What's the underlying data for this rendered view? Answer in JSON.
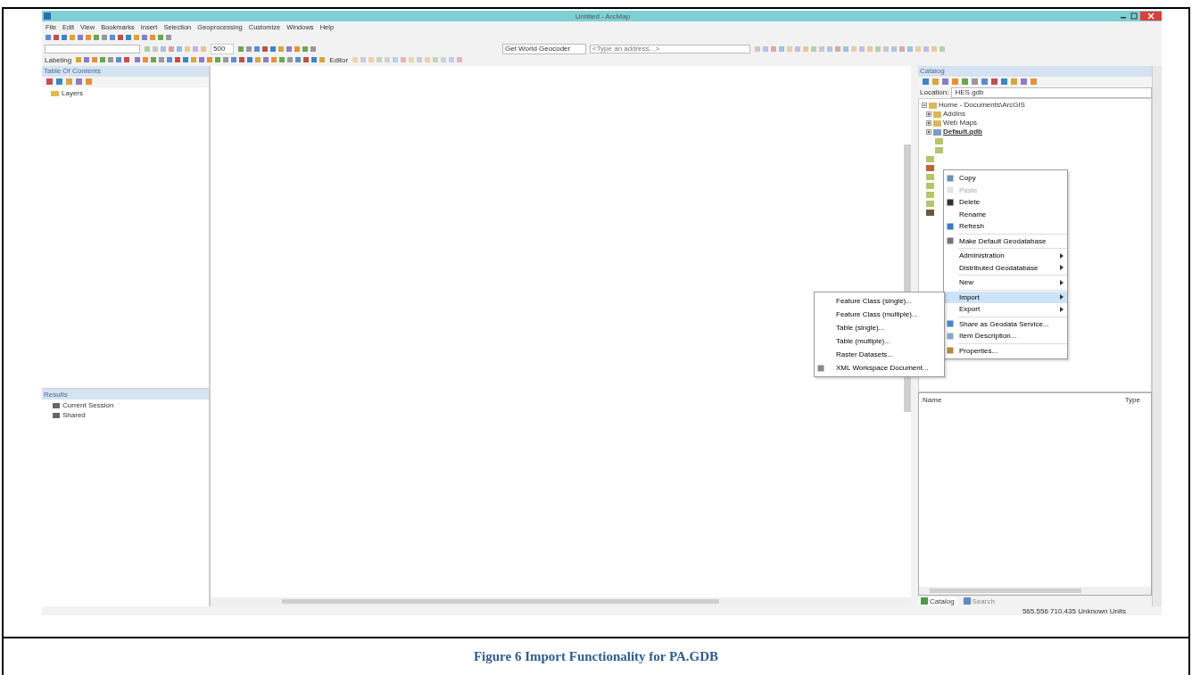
{
  "window": {
    "title": "Untitled - ArcMap"
  },
  "menu_bar": [
    "File",
    "Edit",
    "View",
    "Bookmarks",
    "Insert",
    "Selection",
    "Geoprocessing",
    "Customize",
    "Windows",
    "Help"
  ],
  "toolbars": {
    "scale": "500",
    "labeling": "Labeling",
    "editor": "Editor",
    "geocoder": "Get World Geocoder",
    "address_placeholder": "<Type an address...>"
  },
  "table_of_contents": {
    "title": "Table Of Contents",
    "items": [
      "Layers"
    ]
  },
  "results": {
    "title": "Results",
    "items": [
      "Current Session",
      "Shared"
    ]
  },
  "catalog": {
    "title": "Catalog",
    "location_label": "Location:",
    "location": "HES.gdb",
    "tree": [
      {
        "label": "Home - Documents\\ArcGIS",
        "expanded": true,
        "selected": false,
        "children": [
          {
            "label": "AddIns",
            "expanded": false,
            "selected": false
          },
          {
            "label": "Web Maps",
            "expanded": false,
            "selected": false
          },
          {
            "label": "Default.gdb",
            "expanded": false,
            "selected": true
          }
        ]
      }
    ],
    "columns": [
      "Name",
      "Type"
    ],
    "tabs": [
      {
        "label": "Catalog",
        "selected": true
      },
      {
        "label": "Search",
        "selected": false
      }
    ]
  },
  "context_menu": {
    "sections": [
      [
        {
          "label": "Copy",
          "disabled": false,
          "submenu": false,
          "selected": false
        },
        {
          "label": "Paste",
          "disabled": true,
          "submenu": false,
          "selected": false
        },
        {
          "label": "Delete",
          "disabled": false,
          "submenu": false,
          "selected": false
        },
        {
          "label": "Rename",
          "disabled": false,
          "submenu": false,
          "selected": false
        },
        {
          "label": "Refresh",
          "disabled": false,
          "submenu": false,
          "selected": false
        }
      ],
      [
        {
          "label": "Make Default Geodatabase",
          "disabled": false,
          "submenu": false,
          "selected": false
        }
      ],
      [
        {
          "label": "Administration",
          "disabled": false,
          "submenu": true,
          "selected": false
        },
        {
          "label": "Distributed Geodatabase",
          "disabled": false,
          "submenu": true,
          "selected": false
        }
      ],
      [
        {
          "label": "New",
          "disabled": false,
          "submenu": true,
          "selected": false
        }
      ],
      [
        {
          "label": "Import",
          "disabled": false,
          "submenu": true,
          "selected": true
        },
        {
          "label": "Export",
          "disabled": false,
          "submenu": true,
          "selected": false
        }
      ],
      [
        {
          "label": "Share as Geodata Service...",
          "disabled": false,
          "submenu": false,
          "selected": false
        },
        {
          "label": "Item Description...",
          "disabled": false,
          "submenu": false,
          "selected": false
        }
      ],
      [
        {
          "label": "Properties...",
          "disabled": false,
          "submenu": false,
          "selected": false
        }
      ]
    ]
  },
  "import_submenu": [
    "Feature Class (single)...",
    "Feature Class (multiple)...",
    "Table (single)...",
    "Table (multiple)...",
    "Raster Datasets...",
    "XML Workspace Document..."
  ],
  "status_bar": "565.556  710.435 Unknown Units",
  "caption": "Figure 6 Import Functionality for PA.GDB"
}
